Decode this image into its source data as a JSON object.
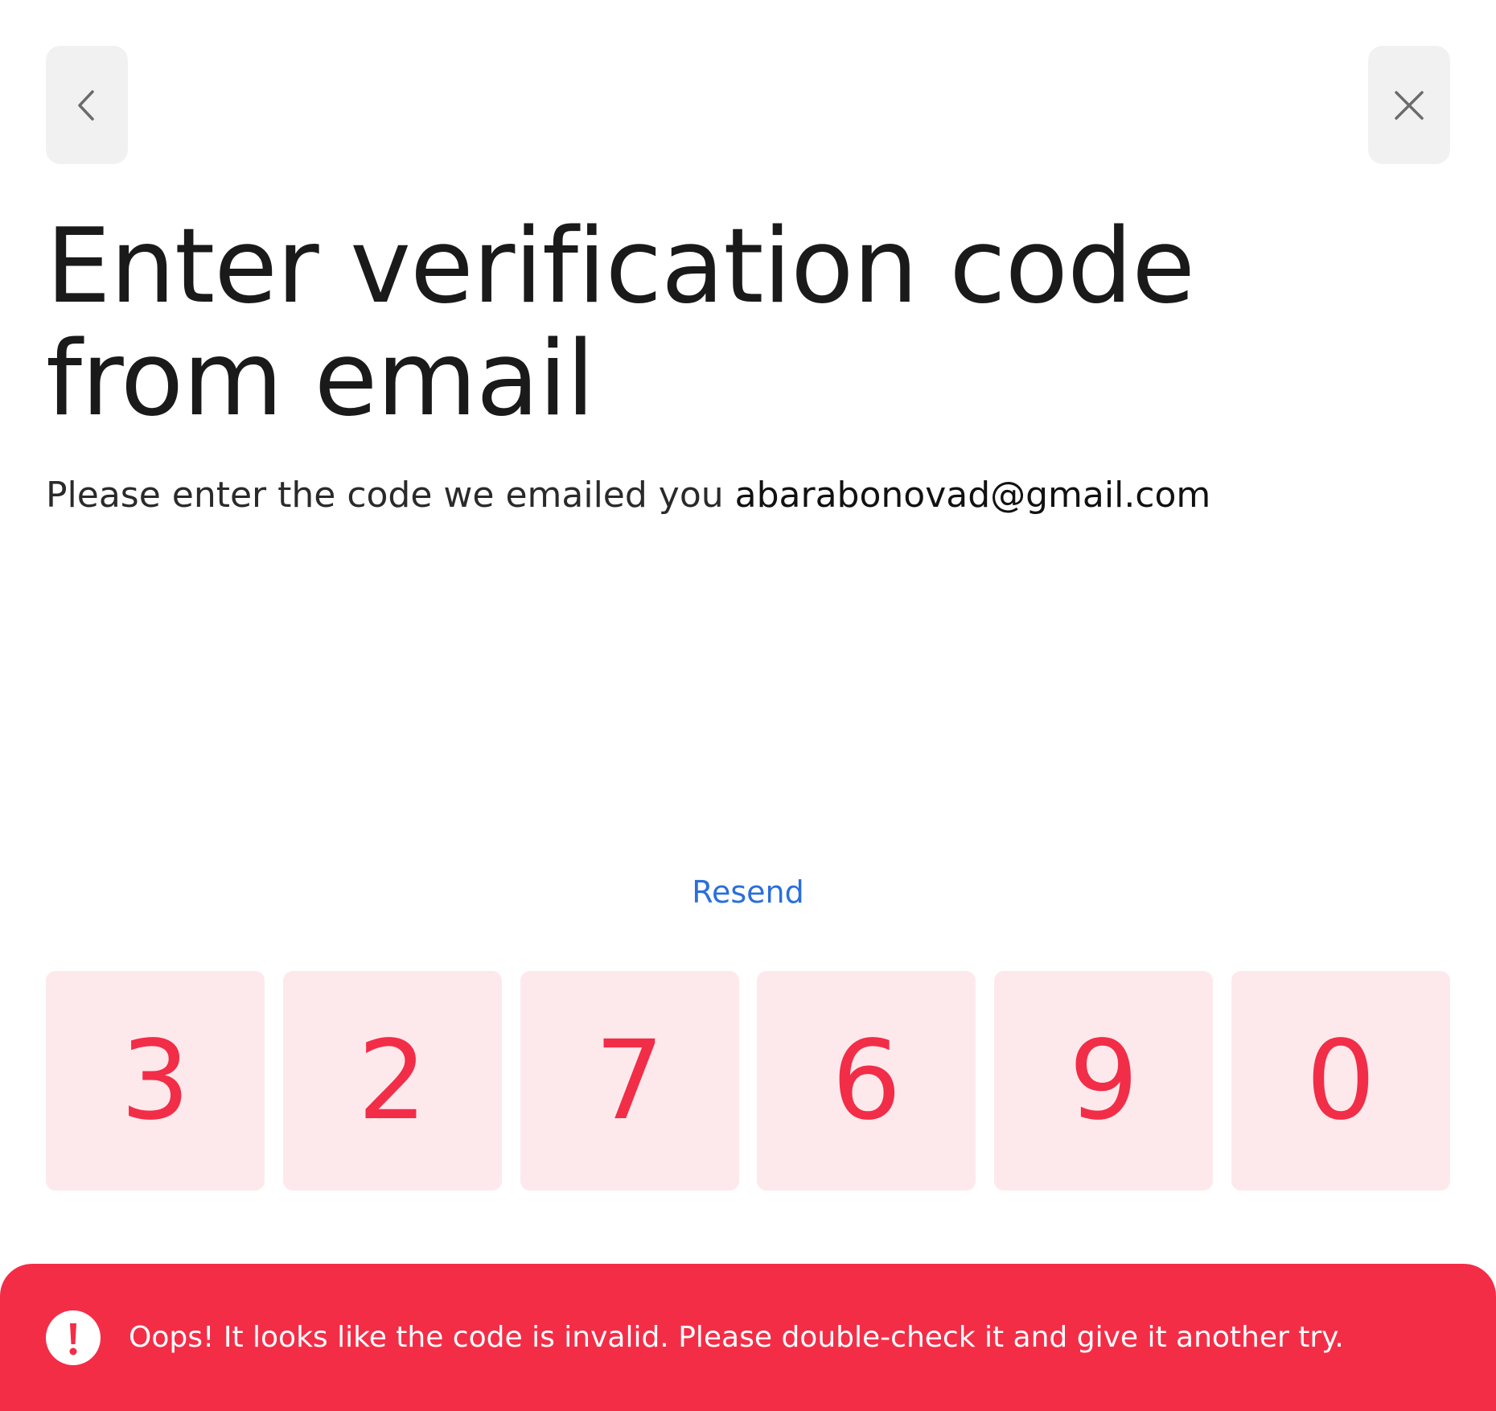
{
  "header": {
    "back_icon": "chevron-left-icon",
    "close_icon": "close-icon"
  },
  "title": {
    "line1": "Enter verification code",
    "line2": "from email"
  },
  "subtitle": {
    "prefix": "Please enter the code we emailed you ",
    "email": "abarabonovad@gmail.com"
  },
  "resend_label": "Resend",
  "code": {
    "digits": [
      "3",
      "2",
      "7",
      "6",
      "9",
      "0"
    ]
  },
  "error": {
    "icon": "alert-icon",
    "message": "Oops! It looks like the code is invalid. Please double-check it and give it another try."
  },
  "colors": {
    "error": "#f42d47",
    "error_digit": "#f22d48",
    "cell_background": "#fde9ec",
    "link": "#2a6fdb",
    "button_background": "#f1f1f1"
  }
}
